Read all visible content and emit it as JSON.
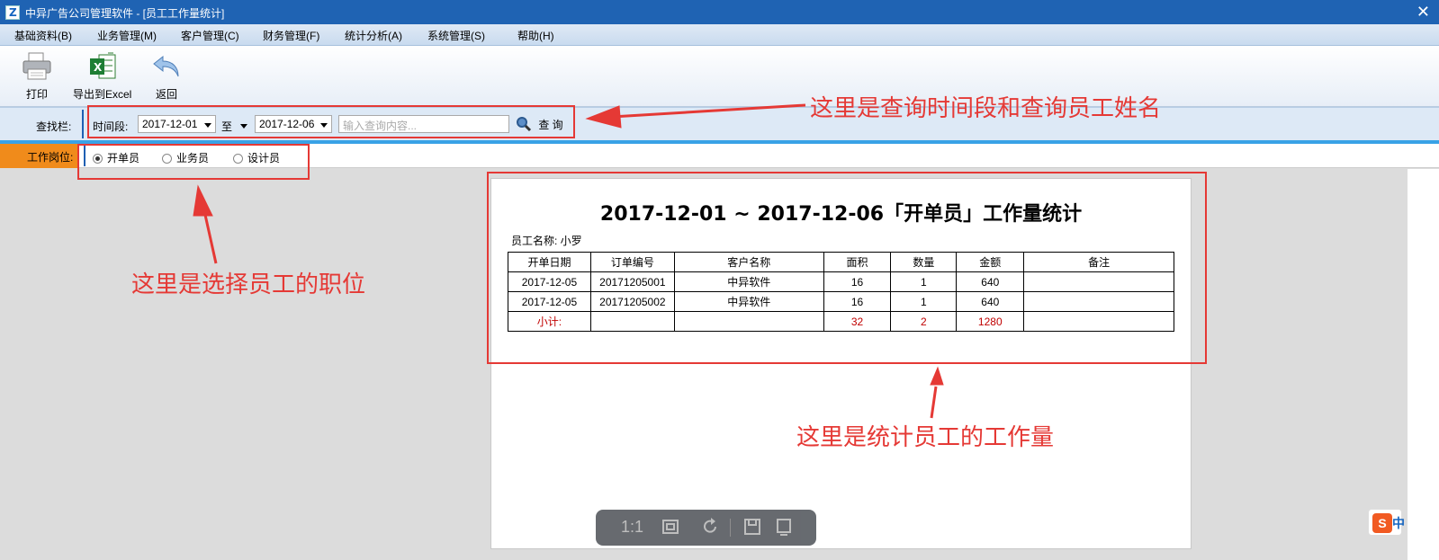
{
  "window": {
    "title": "中异广告公司管理软件 - [员工工作量统计]",
    "close": "✕"
  },
  "menu": [
    "基础资料(B)",
    "业务管理(M)",
    "客户管理(C)",
    "财务管理(F)",
    "统计分析(A)",
    "系统管理(S)",
    "帮助(H)"
  ],
  "toolbar": {
    "print": "打印",
    "export": "导出到Excel",
    "back": "返回"
  },
  "search": {
    "label": "查找栏:",
    "period_label": "时间段:",
    "date_from": "2017-12-01",
    "to_label": "至",
    "date_to": "2017-12-06",
    "placeholder": "输入查询内容...",
    "button": "查 询"
  },
  "position": {
    "label": "工作岗位:",
    "options": [
      "开单员",
      "业务员",
      "设计员"
    ],
    "selected": "开单员"
  },
  "report": {
    "title": "2017-12-01 ~ 2017-12-06「开单员」工作量统计",
    "employee": "员工名称: 小罗",
    "headers": [
      "开单日期",
      "订单编号",
      "客户名称",
      "面积",
      "数量",
      "金额",
      "备注"
    ],
    "rows": [
      [
        "2017-12-05",
        "20171205001",
        "中异软件",
        "16",
        "1",
        "640",
        ""
      ],
      [
        "2017-12-05",
        "20171205002",
        "中异软件",
        "16",
        "1",
        "640",
        ""
      ]
    ],
    "subtotal": [
      "小计:",
      "",
      "",
      "32",
      "2",
      "1280",
      ""
    ]
  },
  "annotations": {
    "search": "这里是查询时间段和查询员工姓名",
    "position": "这里是选择员工的职位",
    "stats": "这里是统计员工的工作量"
  },
  "viewer": {
    "ratio": "1:1"
  },
  "ime": {
    "s": "S",
    "c": "中"
  },
  "colors": {
    "titlebar": "#1f63b3",
    "accent": "#39a2e6",
    "position_tab": "#f08b1b",
    "annotation": "#e53935",
    "subtotal": "#c00000"
  }
}
